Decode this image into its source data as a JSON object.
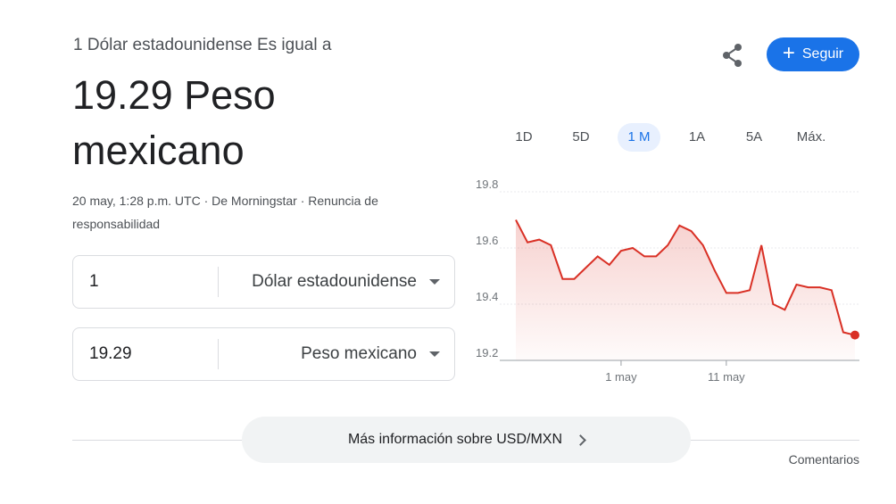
{
  "conversion": {
    "header": "1 Dólar estadounidense Es igual a",
    "result": "19.29 Peso mexicano",
    "timestamp_line": "20 may, 1:28 p.m. UTC · De Morningstar · Renuncia de responsabilidad"
  },
  "converter": {
    "from_amount": "1",
    "from_currency": "Dólar estadounidense",
    "to_amount": "19.29",
    "to_currency": "Peso mexicano"
  },
  "actions": {
    "share_icon": "share-icon",
    "follow_label": "Seguir"
  },
  "ranges": {
    "items": [
      "1D",
      "5D",
      "1 M",
      "1A",
      "5A",
      "Máx."
    ],
    "active": "1 M"
  },
  "chart_data": {
    "type": "area",
    "yticks": [
      "19.8",
      "19.6",
      "19.4",
      "19.2"
    ],
    "ylim": [
      19.2,
      19.8
    ],
    "xticks": [
      {
        "label": "1 may",
        "index": 9
      },
      {
        "label": "11 may",
        "index": 18
      }
    ],
    "values": [
      19.7,
      19.62,
      19.63,
      19.61,
      19.49,
      19.49,
      19.53,
      19.57,
      19.54,
      19.59,
      19.6,
      19.57,
      19.57,
      19.61,
      19.68,
      19.66,
      19.61,
      19.52,
      19.44,
      19.44,
      19.45,
      19.61,
      19.4,
      19.38,
      19.47,
      19.46,
      19.46,
      19.45,
      19.3,
      19.29
    ],
    "line_color": "#d93025",
    "grid": true
  },
  "footer": {
    "more_info": "Más información sobre USD/MXN",
    "feedback": "Comentarios"
  }
}
